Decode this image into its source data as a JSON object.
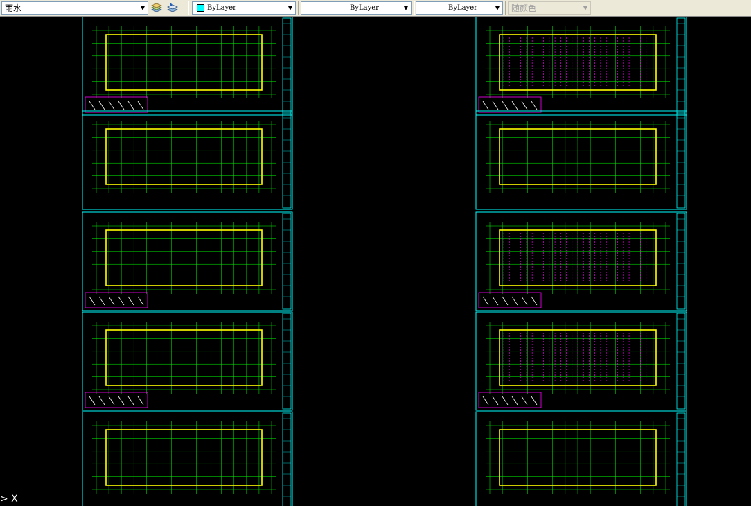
{
  "toolbar": {
    "layer_name": "雨水",
    "color_label": "ByLayer",
    "linetype_label": "ByLayer",
    "lineweight_label": "ByLayer",
    "plotstyle_label": "随颜色",
    "icons": [
      "layer-states-icon",
      "layer-previous-icon",
      "color-swatch-icon"
    ],
    "colors": {
      "toolbar_bg": "#ece9d8",
      "layer_swatch": "#00ffff"
    }
  },
  "drawing": {
    "background": "#000000",
    "sheet_border_color": "#00ffff",
    "grid_color": "#00ff00",
    "wall_color": "#ffff00",
    "accent_color": "#ff00ff",
    "sheets_per_column": 5,
    "columns": 2
  },
  "ucs": {
    "label": "> X"
  }
}
